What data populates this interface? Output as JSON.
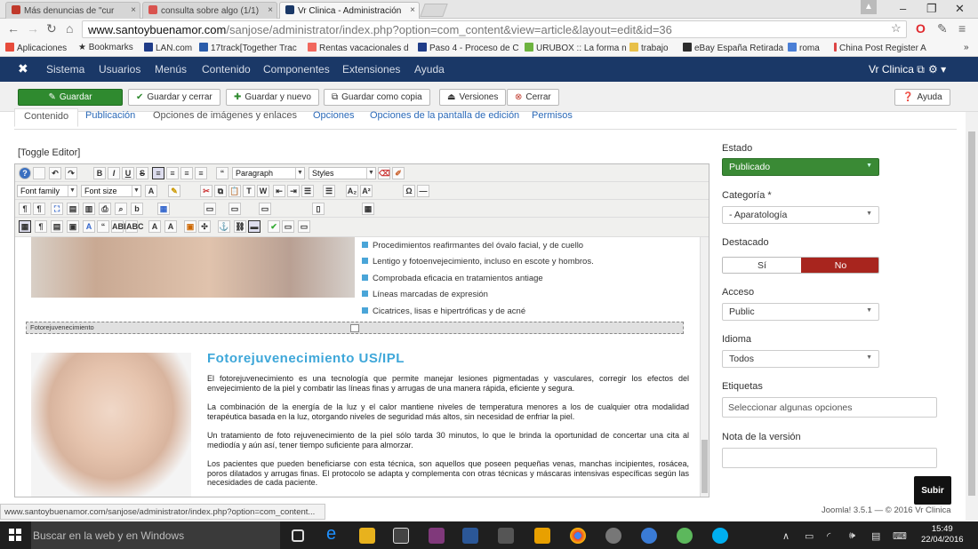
{
  "browser": {
    "tabs": [
      {
        "label": "Más denuncias de \"cur",
        "fav_color": "#c0392b"
      },
      {
        "label": "consulta sobre algo (1/1)",
        "fav_color": "#d9534f"
      },
      {
        "label": "Vr Clinica - Administración",
        "fav_color": "#1a3867"
      }
    ],
    "url_domain": "www.santoybuenamor.com",
    "url_path": "/sanjose/administrator/index.php?option=com_content&view=article&layout=edit&id=36",
    "bookmarks": [
      "Aplicaciones",
      "Bookmarks",
      "LAN.com",
      "17track[Together Trac",
      "Rentas vacacionales d",
      "Paso 4 - Proceso de C",
      "URUBOX :: La forma n",
      "trabajo",
      "eBay España Retirada",
      "roma",
      "China Post Register A"
    ]
  },
  "joomla": {
    "menu": [
      "Sistema",
      "Usuarios",
      "Menús",
      "Contenido",
      "Componentes",
      "Extensiones",
      "Ayuda"
    ],
    "site_link": "Vr Clinica",
    "toolbar": {
      "save": "Guardar",
      "save_close": "Guardar y cerrar",
      "save_new": "Guardar y nuevo",
      "save_copy": "Guardar como copia",
      "versions": "Versiones",
      "close": "Cerrar",
      "help": "Ayuda"
    },
    "tabs": [
      "Contenido",
      "Publicación",
      "Opciones de imágenes y enlaces",
      "Opciones",
      "Opciones de la pantalla de edición",
      "Permisos"
    ],
    "toggle_editor": "[Toggle Editor]",
    "editor_toolbar": {
      "format": "Paragraph",
      "styles": "Styles",
      "font_family": "Font family",
      "font_size": "Font size"
    },
    "content": {
      "bullets": [
        "Procedimientos reafirmantes del óvalo facial, y de cuello",
        "Lentigo y fotoenvejecimiento, incluso en escote y hombros.",
        "Comprobada eficacia en tratamientos antiage",
        "Líneas marcadas de expresión",
        "Cicatrices, lisas e hipertróficas y de acné"
      ],
      "divider_label": "Fotorejuvenecimiento",
      "heading": "Fotorejuvenecimiento  US/IPL",
      "paragraphs": [
        "El fotorejuvenecimiento es una tecnología que permite manejar lesiones pigmentadas y vasculares, corregir los efectos del envejecimiento de la piel y combatir las líneas finas y arrugas de una manera rápida, eficiente y segura.",
        "La combinación de la energía de la luz y el calor mantiene niveles de temperatura menores a los de cualquier otra modalidad terapéutica basada en la luz, otorgando niveles de seguridad más altos, sin necesidad de enfriar la piel.",
        "Un tratamiento de foto rejuvenecimiento de la piel sólo tarda 30 minutos, lo que le brinda la oportunidad de concertar una cita al mediodía y aún así, tener tiempo suficiente para almorzar.",
        "Los pacientes que pueden beneficiarse con esta técnica, son aquellos que poseen pequeñas venas, manchas incipientes, rosácea, poros dilatados y arrugas finas. El protocolo se adapta y complementa con otras técnicas y máscaras intensivas específicas según las necesidades de cada paciente."
      ]
    },
    "sidebar": {
      "estado_label": "Estado",
      "estado_value": "Publicado",
      "categoria_label": "Categoría *",
      "categoria_value": "- Aparatología",
      "destacado_label": "Destacado",
      "yes": "Sí",
      "no": "No",
      "acceso_label": "Acceso",
      "acceso_value": "Public",
      "idioma_label": "Idioma",
      "idioma_value": "Todos",
      "etiquetas_label": "Etiquetas",
      "etiquetas_placeholder": "Seleccionar algunas opciones",
      "nota_label": "Nota de la versión",
      "nota_value": ""
    },
    "subir": "Subir",
    "footer": "Joomla! 3.5.1 — © 2016 Vr Clinica"
  },
  "status_url": "www.santoybuenamor.com/sanjose/administrator/index.php?option=com_content...",
  "taskbar": {
    "search": "Buscar en la web y en Windows",
    "time": "15:49",
    "date": "22/04/2016"
  },
  "colors": {
    "joomla_nav": "#1a3867",
    "save_green": "#2f8a2f",
    "no_red": "#a8251e",
    "heading_blue": "#3ea7d9"
  }
}
